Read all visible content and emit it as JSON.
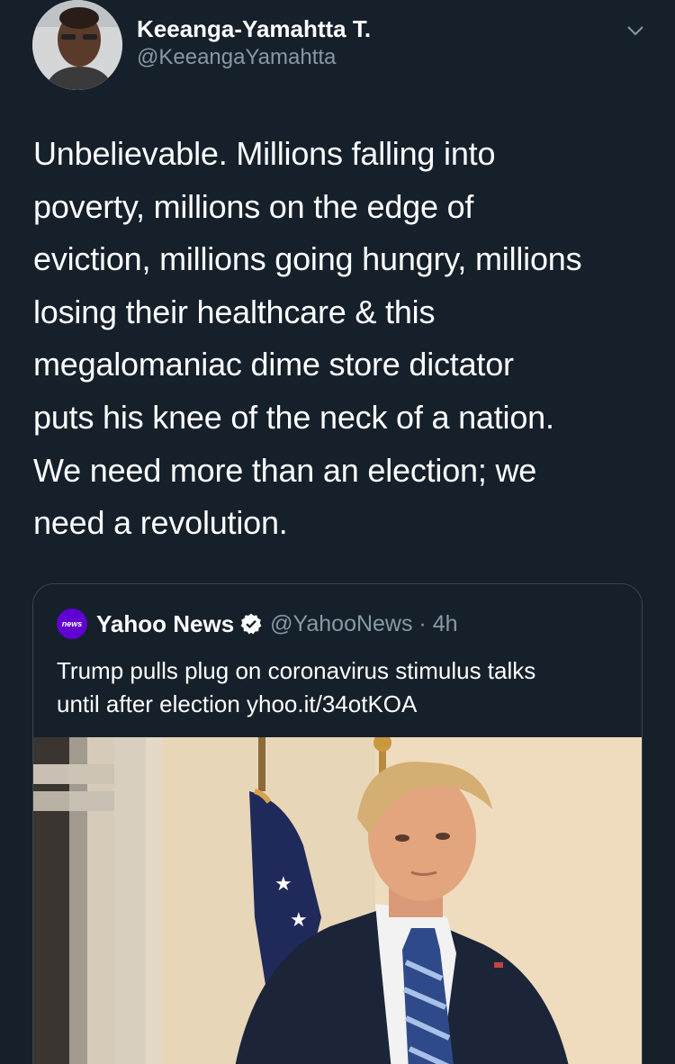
{
  "author": {
    "display_name": "Keeanga-Yamahtta T.",
    "handle": "@KeeangaYamahtta"
  },
  "tweet": {
    "text": "Unbelievable. Millions falling into\npoverty, millions on the edge of\neviction, millions going hungry, millions\nlosing their healthcare & this\nmegalomaniac dime store dictator\nputs his knee of the neck of a nation.\nWe need more than an election; we\nneed a revolution."
  },
  "quoted_tweet": {
    "avatar_label": "news",
    "name": "Yahoo News",
    "handle_time": "@YahooNews · 4h",
    "text": "Trump pulls plug on coronavirus stimulus talks\nuntil after election yhoo.it/34otKOA"
  },
  "icons": {
    "menu": "chevron-down-icon",
    "verified": "verified-badge-icon"
  },
  "colors": {
    "background": "#15202b",
    "secondary_text": "#8899a6",
    "border": "#38444d",
    "yahoo_purple": "#6001d2"
  }
}
